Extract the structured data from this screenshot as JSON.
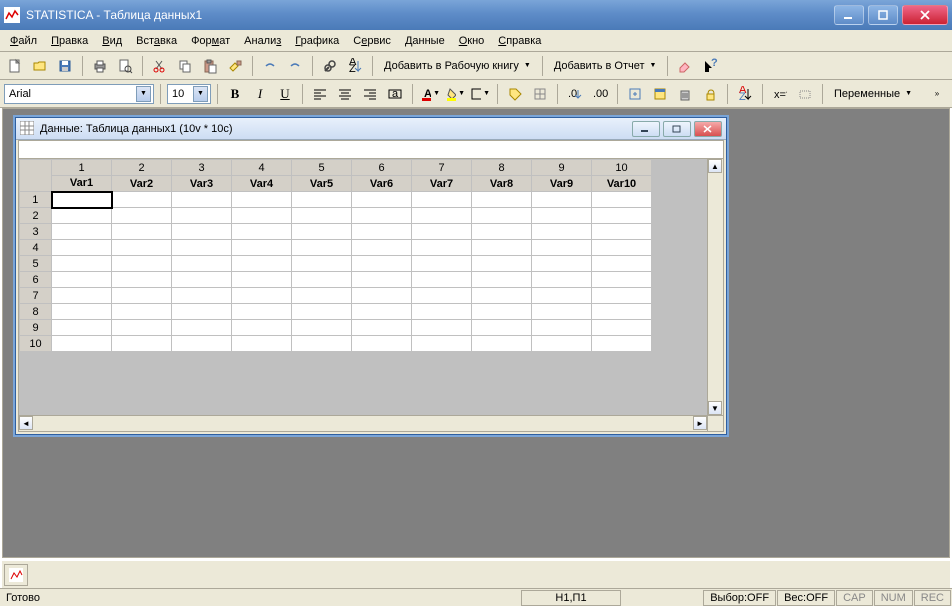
{
  "app": {
    "title": "STATISTICA - Таблица данных1"
  },
  "menu": {
    "file": "Файл",
    "edit": "Правка",
    "view": "Вид",
    "insert": "Вставка",
    "format": "Формат",
    "analysis": "Анализ",
    "graphics": "Графика",
    "service": "Сервис",
    "data": "Данные",
    "window": "Окно",
    "help": "Справка"
  },
  "toolbar": {
    "add_workbook": "Добавить в Рабочую книгу",
    "add_report": "Добавить в Отчет"
  },
  "font": {
    "name": "Arial",
    "size": "10"
  },
  "vars_button": "Переменные",
  "child": {
    "title": "Данные: Таблица данных1 (10v * 10c)",
    "columns": [
      {
        "num": "1",
        "name": "Var1"
      },
      {
        "num": "2",
        "name": "Var2"
      },
      {
        "num": "3",
        "name": "Var3"
      },
      {
        "num": "4",
        "name": "Var4"
      },
      {
        "num": "5",
        "name": "Var5"
      },
      {
        "num": "6",
        "name": "Var6"
      },
      {
        "num": "7",
        "name": "Var7"
      },
      {
        "num": "8",
        "name": "Var8"
      },
      {
        "num": "9",
        "name": "Var9"
      },
      {
        "num": "10",
        "name": "Var10"
      }
    ],
    "rows": [
      "1",
      "2",
      "3",
      "4",
      "5",
      "6",
      "7",
      "8",
      "9",
      "10"
    ]
  },
  "status": {
    "ready": "Готово",
    "pos": "Н1,П1",
    "vybor": "Выбор:OFF",
    "ves": "Вес:OFF",
    "cap": "CAP",
    "num": "NUM",
    "rec": "REC"
  }
}
